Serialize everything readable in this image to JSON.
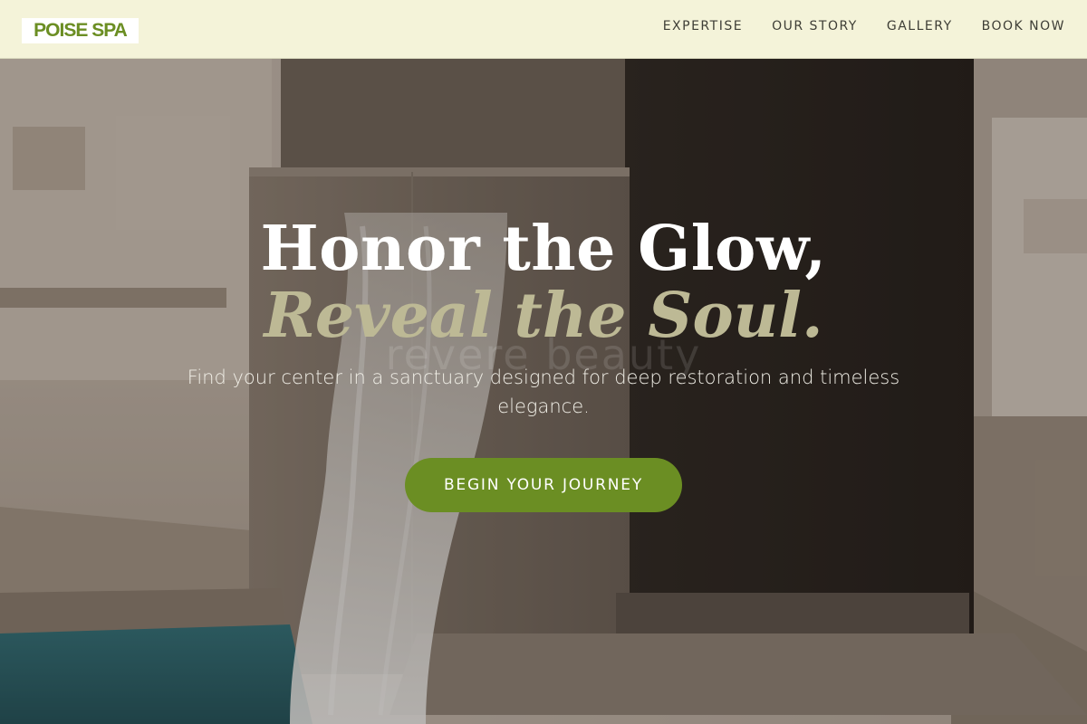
{
  "brand": {
    "logo_text": "POISE SPA",
    "accent_color": "#6b8e23",
    "header_bg": "#f4f3d9"
  },
  "nav": {
    "items": [
      {
        "label": "EXPERTISE"
      },
      {
        "label": "OUR STORY"
      },
      {
        "label": "GALLERY"
      },
      {
        "label": "BOOK NOW"
      }
    ]
  },
  "hero": {
    "headline_line1": "Honor the Glow,",
    "headline_line2": "Reveal the Soul.",
    "ghost_text": "revere beauty",
    "subtext": "Find your center in a sanctuary designed for deep restoration and timeless elegance.",
    "cta_label": "BEGIN YOUR JOURNEY",
    "headline2_color": "#bdb995"
  }
}
